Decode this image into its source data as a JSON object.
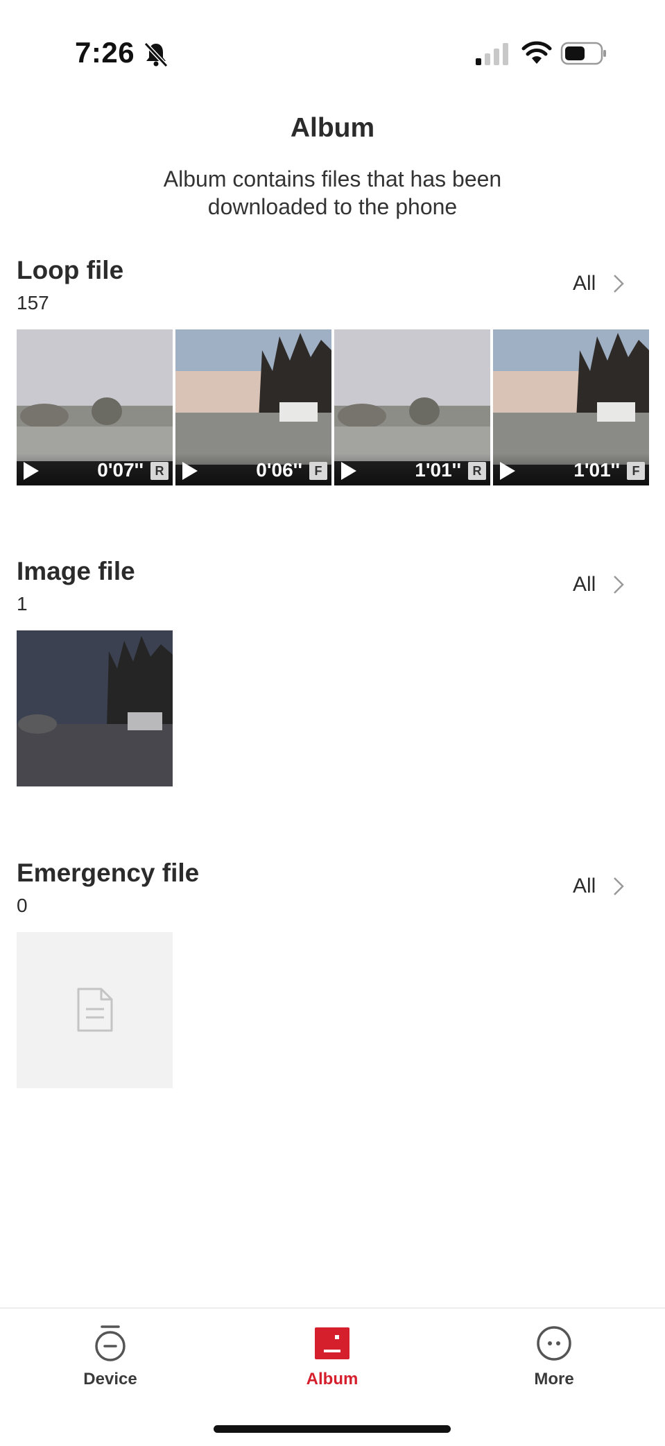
{
  "status_bar": {
    "time": "7:26"
  },
  "header": {
    "title": "Album",
    "subtitle": "Album contains files that has been downloaded to the phone"
  },
  "sections": [
    {
      "title": "Loop file",
      "count": "157",
      "all_label": "All",
      "items": [
        {
          "duration": "0'07''",
          "camera": "R"
        },
        {
          "duration": "0'06''",
          "camera": "F"
        },
        {
          "duration": "1'01''",
          "camera": "R"
        },
        {
          "duration": "1'01''",
          "camera": "F"
        }
      ]
    },
    {
      "title": "Image file",
      "count": "1",
      "all_label": "All"
    },
    {
      "title": "Emergency file",
      "count": "0",
      "all_label": "All"
    }
  ],
  "tab_bar": {
    "accent_color": "#d51f2d",
    "tabs": [
      {
        "label": "Device",
        "icon": "device-icon",
        "active": false
      },
      {
        "label": "Album",
        "icon": "album-icon",
        "active": true
      },
      {
        "label": "More",
        "icon": "more-icon",
        "active": false
      }
    ]
  }
}
